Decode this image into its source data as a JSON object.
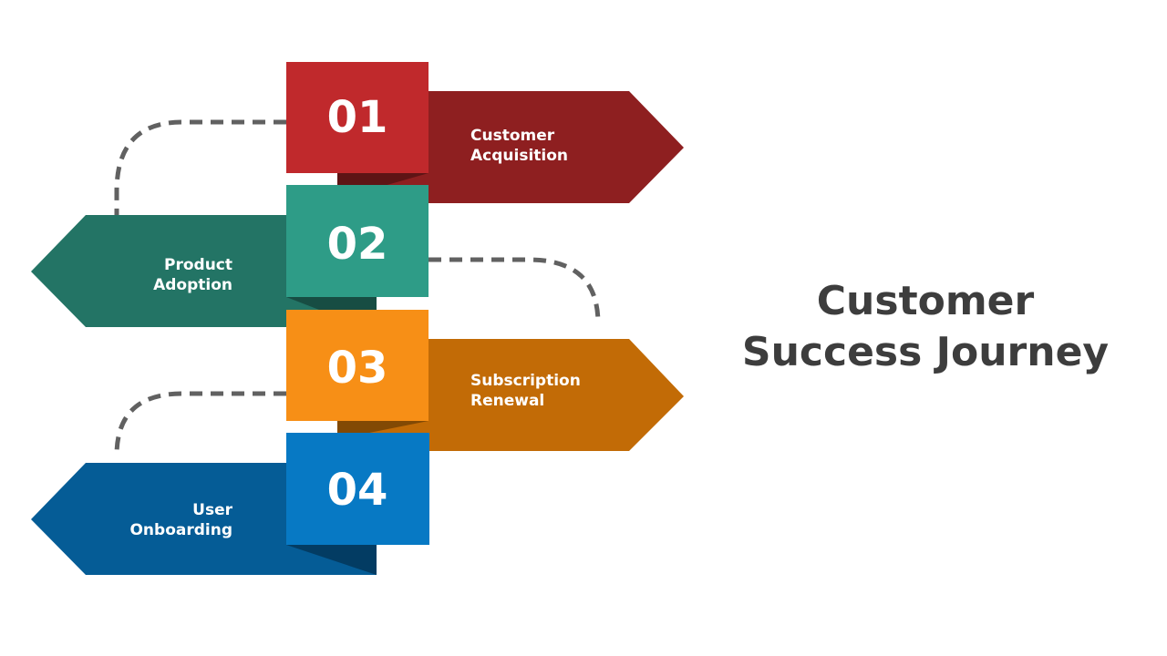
{
  "title": {
    "line1": "Customer",
    "line2": "Success Journey"
  },
  "steps": [
    {
      "number": "01",
      "label_line1": "Customer",
      "label_line2": "Acquisition",
      "direction": "right",
      "box_color": "#c0292c",
      "arrow_color": "#8e1f20",
      "shadow_color": "#5e1415"
    },
    {
      "number": "02",
      "label_line1": "Product",
      "label_line2": "Adoption",
      "direction": "left",
      "box_color": "#2e9c87",
      "arrow_color": "#237465",
      "shadow_color": "#174d43"
    },
    {
      "number": "03",
      "label_line1": "Subscription",
      "label_line2": "Renewal",
      "direction": "right",
      "box_color": "#f78f16",
      "arrow_color": "#c26b06",
      "shadow_color": "#824904"
    },
    {
      "number": "04",
      "label_line1": "User",
      "label_line2": "Onboarding",
      "direction": "left",
      "box_color": "#0779c4",
      "arrow_color": "#055c96",
      "shadow_color": "#033c63"
    }
  ],
  "connector_color": "#616161"
}
